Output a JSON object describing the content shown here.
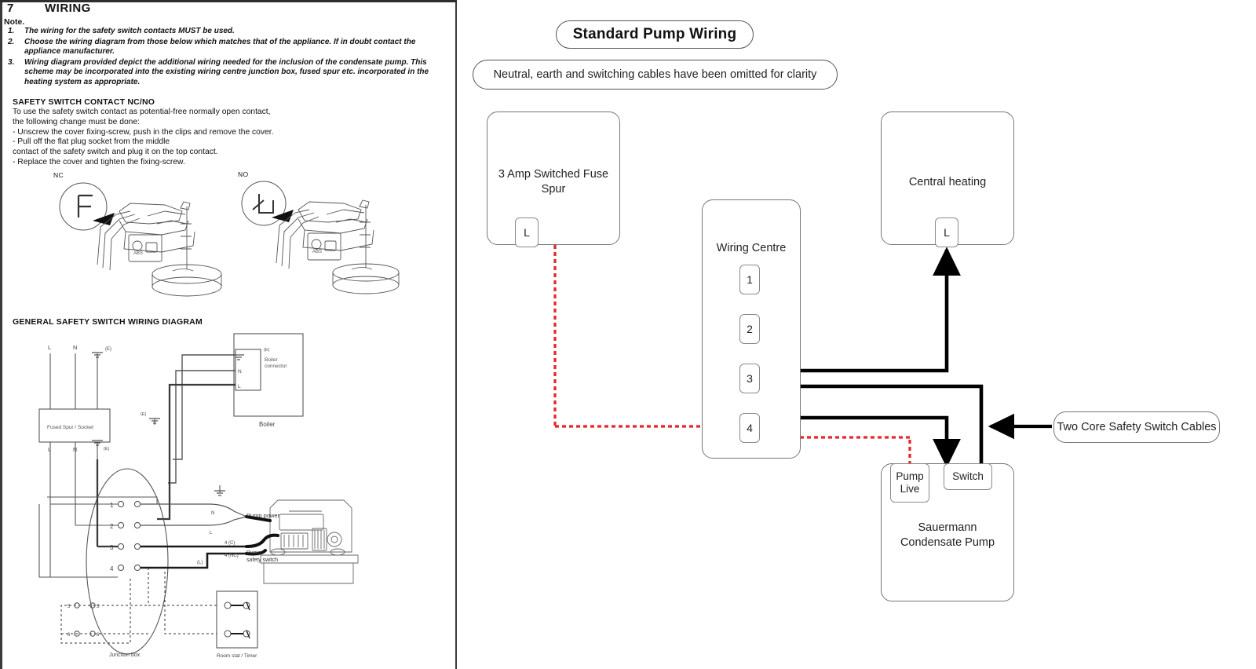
{
  "document": {
    "section_number": "7",
    "section_title": "WIRING",
    "note_label": "Note."
  },
  "notes": [
    {
      "index": "1.",
      "text": "The wiring for the safety switch contacts MUST be used."
    },
    {
      "index": "2.",
      "text": "Choose the wiring diagram from those below which matches that of the appliance. If in doubt contact the appliance manufacturer."
    },
    {
      "index": "3.",
      "text": "Wiring diagram provided depict the additional wiring needed for the inclusion of the condensate pump. This scheme may be incorporated into the existing wiring centre junction box, fused spur etc. incorporated in the heating system as appropriate."
    }
  ],
  "safety_switch_contact": {
    "heading": "SAFETY SWITCH CONTACT NC/NO",
    "lines": [
      "To use the safety switch contact as potential-free normally open contact,",
      "the following change must be done:",
      "- Unscrew the cover fixing-screw, push in the clips and remove the cover.",
      "- Pull off the flat plug socket from the middle",
      "contact of the safety switch and plug it on the top contact.",
      "- Replace the cover and tighten the fixing-screw."
    ],
    "nc_label": "NC",
    "no_label": "NO"
  },
  "general_diagram": {
    "heading": "GENERAL SAFETY SWITCH WIRING DIAGRAM",
    "supply_labels": {
      "live": "L",
      "neutral": "N",
      "earth": "(E)"
    },
    "fused_spur_label": "Fused Spur / Socket",
    "fused_spur_terminals": {
      "live": "L",
      "neutral": "N",
      "earth": "(E)"
    },
    "boiler_box_label": "Boiler",
    "boiler_connector_label": "Boiler connector",
    "boiler_terminals": {
      "earth": "(E)",
      "neutral": "N",
      "live": "L"
    },
    "junction_earth_label": "(E)",
    "junction_box_label": "Junction box",
    "junction_terminals": [
      "1",
      "2",
      "3",
      "4"
    ],
    "junction_lower_terminals": [
      "5",
      "6"
    ],
    "wire_labels": {
      "earth": "(E)",
      "neutral": "N",
      "live": "L",
      "live_paren": "(L)"
    },
    "pump_power_label": "Pump power",
    "pump_safety_switch_label": "Pump safety switch",
    "contact_nc_label": "4 (NC)",
    "contact_c_label": "4 (C)",
    "room_stat_label": "Room stat / Timer",
    "pump_casing_label": "ABS"
  },
  "right_diagram": {
    "title": "Standard Pump Wiring",
    "note": "Neutral, earth and switching cables have been omitted for clarity",
    "fuse_spur": {
      "label_line1": "3 Amp Switched Fuse",
      "label_line2": "Spur",
      "terminal": "L"
    },
    "wiring_centre": {
      "label": "Wiring Centre",
      "terminals": [
        "1",
        "2",
        "3",
        "4"
      ]
    },
    "central_heating": {
      "label": "Central heating",
      "terminal": "L"
    },
    "pump": {
      "label_line1": "Sauermann",
      "label_line2": "Condensate Pump",
      "live_terminal_line1": "Pump",
      "live_terminal_line2": "Live",
      "switch_terminal": "Switch"
    },
    "cable_callout": "Two Core Safety Switch Cables",
    "colors": {
      "live_wire": "#e8262a",
      "switch_wire": "#000000",
      "box_outline": "#777777",
      "pill_outline": "#555555"
    }
  }
}
